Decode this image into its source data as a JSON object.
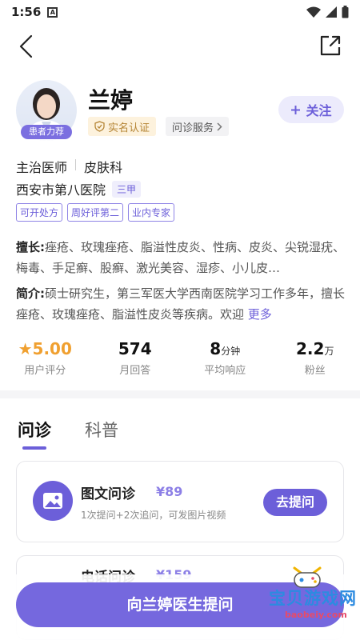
{
  "status": {
    "time": "1:56",
    "a_badge": "A"
  },
  "doctor": {
    "avatar_badge": "患者力荐",
    "name": "兰婷",
    "verify_label": "实名认证",
    "consult_service": "问诊服务",
    "follow_label": "关注",
    "title": "主治医师",
    "department": "皮肤科",
    "hospital": "西安市第八医院",
    "hospital_level": "三甲",
    "tags": [
      "可开处方",
      "周好评第二",
      "业内专家"
    ]
  },
  "expertise": {
    "label": "擅长:",
    "text": "痤疮、玫瑰痤疮、脂溢性皮炎、性病、皮炎、尖锐湿疣、梅毒、手足癣、股癣、激光美容、湿疹、小儿皮…"
  },
  "intro": {
    "label": "简介:",
    "text": "硕士研究生，第三军医大学西南医院学习工作多年，擅长痤疮、玫瑰痤疮、脂溢性皮炎等疾病。欢迎",
    "more": "更多"
  },
  "stats": [
    {
      "value": "5.00",
      "unit": "",
      "label": "用户评分"
    },
    {
      "value": "574",
      "unit": "",
      "label": "月回答"
    },
    {
      "value": "8",
      "unit": "分钟",
      "label": "平均响应"
    },
    {
      "value": "2.2",
      "unit": "万",
      "label": "粉丝"
    }
  ],
  "tabs": [
    "问诊",
    "科普"
  ],
  "services": [
    {
      "title": "图文问诊",
      "price": "¥89",
      "desc": "1次提问+2次追问，可发图片视频",
      "button": "去提问"
    },
    {
      "title": "电话问诊",
      "price": "¥159"
    }
  ],
  "cta_label": "向兰婷医生提问",
  "watermark": {
    "text": "宝贝游戏网",
    "url": "baobeiy.com"
  },
  "colors": {
    "accent": "#6c5fd9",
    "star": "#f0a030",
    "verify_bg": "#fdf2dd"
  }
}
